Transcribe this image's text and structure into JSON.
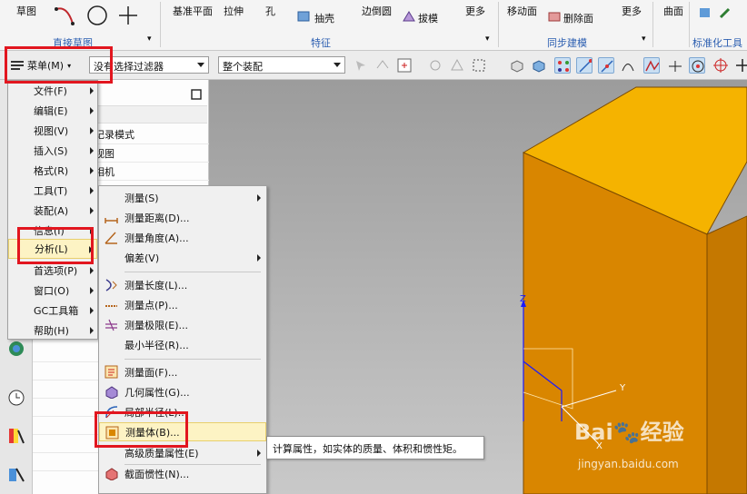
{
  "ribbon": {
    "sketch_label": "草图",
    "direct_sketch_group": "直接草图",
    "datum_plane": "基准平面",
    "extrude": "拉伸",
    "hole": "孔",
    "shell": "抽壳",
    "edge_blend": "边倒圆",
    "draft": "拔模",
    "more_1": "更多",
    "feature_group": "特征",
    "move_face": "移动面",
    "delete_face": "删除面",
    "more_2": "更多",
    "sync_group": "同步建模",
    "surface": "曲面",
    "standard_tools_group": "标准化工具"
  },
  "toolbar": {
    "menu_label": "菜单(M)",
    "filter_value": "没有选择过滤器",
    "assembly_value": "整个装配"
  },
  "nav_panel": {
    "rows": [
      "记录模式",
      "视图",
      "相机"
    ]
  },
  "main_menu": {
    "items": [
      {
        "label": "文件(F)",
        "has_sub": true
      },
      {
        "label": "编辑(E)",
        "has_sub": true
      },
      {
        "label": "视图(V)",
        "has_sub": true
      },
      {
        "label": "插入(S)",
        "has_sub": true
      },
      {
        "label": "格式(R)",
        "has_sub": true
      },
      {
        "label": "工具(T)",
        "has_sub": true
      },
      {
        "label": "装配(A)",
        "has_sub": true
      },
      {
        "label": "信息(I)",
        "has_sub": true
      },
      {
        "label": "分析(L)",
        "has_sub": true,
        "highlighted": true
      },
      {
        "label": "首选项(P)",
        "has_sub": true
      },
      {
        "label": "窗口(O)",
        "has_sub": true
      },
      {
        "label": "GC工具箱",
        "has_sub": true
      },
      {
        "label": "帮助(H)",
        "has_sub": true
      }
    ]
  },
  "analysis_menu": {
    "items": [
      {
        "label": "测量(S)",
        "has_sub": true,
        "icon": "none"
      },
      {
        "label": "测量距离(D)...",
        "has_sub": false,
        "icon": "measure-distance-icon"
      },
      {
        "label": "测量角度(A)...",
        "has_sub": false,
        "icon": "measure-angle-icon"
      },
      {
        "label": "偏差(V)",
        "has_sub": true,
        "icon": "none"
      },
      {
        "label": "测量长度(L)...",
        "has_sub": false,
        "icon": "measure-length-icon"
      },
      {
        "label": "测量点(P)...",
        "has_sub": false,
        "icon": "measure-point-icon"
      },
      {
        "label": "测量极限(E)...",
        "has_sub": false,
        "icon": "measure-limit-icon"
      },
      {
        "label": "最小半径(R)...",
        "has_sub": false,
        "icon": "none"
      },
      {
        "label": "测量面(F)...",
        "has_sub": false,
        "icon": "measure-face-icon"
      },
      {
        "label": "几何属性(G)...",
        "has_sub": false,
        "icon": "geometry-properties-icon"
      },
      {
        "label": "局部半径(L)...",
        "has_sub": false,
        "icon": "local-radius-icon"
      },
      {
        "label": "测量体(B)...",
        "has_sub": false,
        "icon": "measure-body-icon",
        "highlighted": true
      },
      {
        "label": "高级质量属性(E)",
        "has_sub": true,
        "icon": "none"
      },
      {
        "label": "截面惯性(N)...",
        "has_sub": false,
        "icon": "section-inertia-icon"
      }
    ]
  },
  "tooltip": {
    "text": "计算属性，如实体的质量、体积和惯性矩。"
  },
  "viewport": {
    "axis_y": "Y",
    "axis_z": "Z",
    "axis_x": "X",
    "watermark_main": "Bai🐾经验",
    "watermark_sub": "jingyan.baidu.com"
  },
  "colors": {
    "highlight_red": "#e2161f",
    "block_top": "#f5b300",
    "block_front": "#d98600",
    "block_side": "#b86f00",
    "axis_blue": "#1a1aff"
  }
}
